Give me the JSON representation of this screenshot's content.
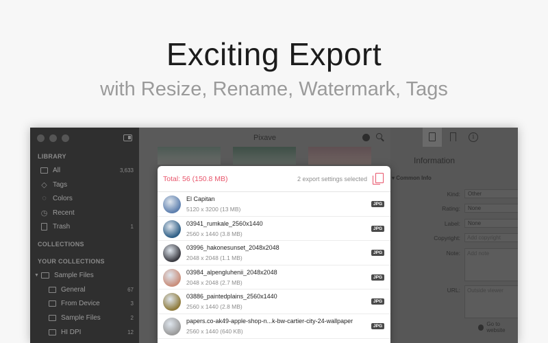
{
  "headline": "Exciting Export",
  "subheadline": "with Resize, Rename, Watermark, Tags",
  "window": {
    "title": "Pixave"
  },
  "sidebar": {
    "library_title": "LIBRARY",
    "library_items": [
      {
        "label": "All",
        "count": "3,633",
        "icon": "tray-icon"
      },
      {
        "label": "Tags",
        "count": "",
        "icon": "tag-icon"
      },
      {
        "label": "Colors",
        "count": "",
        "icon": "palette-icon"
      },
      {
        "label": "Recent",
        "count": "",
        "icon": "clock-icon"
      },
      {
        "label": "Trash",
        "count": "1",
        "icon": "trash-icon"
      }
    ],
    "collections_title": "COLLECTIONS",
    "your_collections_title": "YOUR COLLECTIONS",
    "folder": {
      "label": "Sample Files"
    },
    "sub_items": [
      {
        "label": "General",
        "count": "67"
      },
      {
        "label": "From Device",
        "count": "3"
      },
      {
        "label": "Sample Files",
        "count": "2"
      },
      {
        "label": "HI DPI",
        "count": "12"
      }
    ]
  },
  "export_popover": {
    "total": "Total: 56 (150.8 MB)",
    "settings_text": "2 export settings selected",
    "files": [
      {
        "name": "El Capitan",
        "meta": "5120 x 3200 (13 MB)",
        "badge": "JPG",
        "thumb_color": "#5d7fae"
      },
      {
        "name": "03941_rumkale_2560x1440",
        "meta": "2560 x 1440 (3.8 MB)",
        "badge": "JPG",
        "thumb_color": "#2f5f86"
      },
      {
        "name": "03996_hakonesunset_2048x2048",
        "meta": "2048 x 2048 (1.1 MB)",
        "badge": "JPG",
        "thumb_color": "#3b3b42"
      },
      {
        "name": "03984_alpengluhenii_2048x2048",
        "meta": "2048 x 2048 (2.7 MB)",
        "badge": "JPG",
        "thumb_color": "#c98d7a"
      },
      {
        "name": "03886_paintedplains_2560x1440",
        "meta": "2560 x 1440 (2.8 MB)",
        "badge": "JPG",
        "thumb_color": "#8e7a3a"
      },
      {
        "name": "papers.co-ak49-apple-shop-n...k-bw-cartier-city-24-wallpaper",
        "meta": "2560 x 1440 (640 KB)",
        "badge": "JPG",
        "thumb_color": "#9a9a9a"
      }
    ]
  },
  "inspector": {
    "title": "Information",
    "section": "Common Info",
    "fields": {
      "kind_label": "Kind:",
      "kind_value": "Other",
      "rating_label": "Rating:",
      "rating_value": "None",
      "label_label": "Label:",
      "label_value": "None",
      "copyright_label": "Copyright:",
      "copyright_placeholder": "Add copyright",
      "note_label": "Note:",
      "note_placeholder": "Add note",
      "url_label": "URL:",
      "url_placeholder": "Outside viewer"
    },
    "goto_label": "Go to website"
  }
}
